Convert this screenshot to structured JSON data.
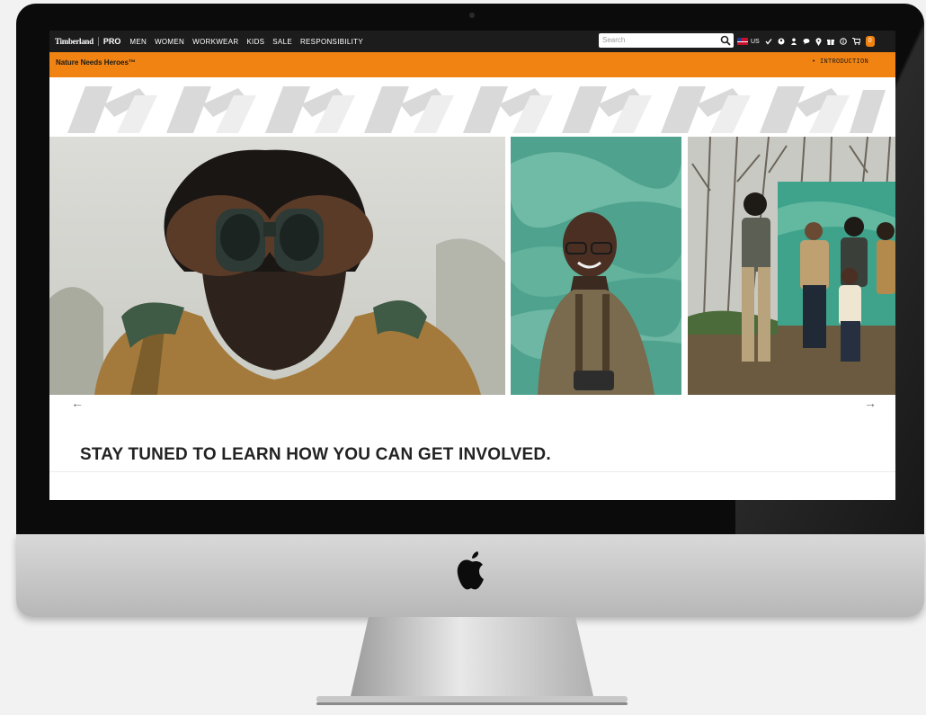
{
  "nav": {
    "brand": "Timberland",
    "sub_brand": "PRO",
    "links": [
      "MEN",
      "WOMEN",
      "WORKWEAR",
      "KIDS",
      "SALE",
      "RESPONSIBILITY"
    ],
    "search_placeholder": "Search",
    "region": "US",
    "cart_count": "0"
  },
  "banner": {
    "title": "Nature Needs Heroes™",
    "link": "• INTRODUCTION"
  },
  "carousel": {
    "prev": "←",
    "next": "→"
  },
  "content": {
    "headline": "STAY TUNED TO LEARN HOW YOU CAN GET INVOLVED."
  },
  "colors": {
    "nav_bg": "#1c1c1c",
    "accent_orange": "#f08312",
    "bezel": "#0b0b0b"
  },
  "icons": [
    "search-icon",
    "us-flag-icon",
    "check-icon",
    "account-icon",
    "user-icon",
    "chat-icon",
    "location-icon",
    "gift-icon",
    "info-icon",
    "cart-icon",
    "apple-logo-icon"
  ]
}
